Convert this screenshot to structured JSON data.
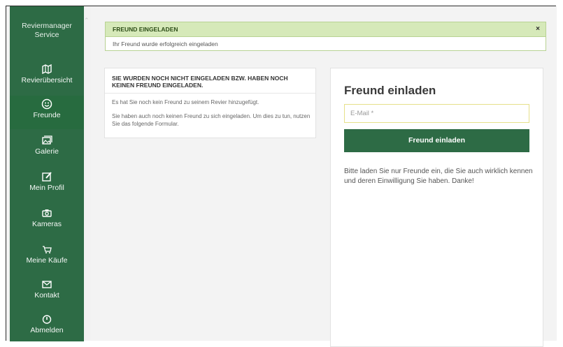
{
  "sidebar": {
    "brand": {
      "line1": "Reviermanager",
      "line2": "Service"
    },
    "items": [
      {
        "label": "Revierübersicht",
        "icon": "map-icon",
        "active": false
      },
      {
        "label": "Freunde",
        "icon": "smiley-icon",
        "active": true
      },
      {
        "label": "Galerie",
        "icon": "gallery-icon",
        "active": false
      },
      {
        "label": "Mein Profil",
        "icon": "edit-icon",
        "active": false
      },
      {
        "label": "Kameras",
        "icon": "camera-icon",
        "active": false
      },
      {
        "label": "Meine Käufe",
        "icon": "cart-icon",
        "active": false
      },
      {
        "label": "Kontakt",
        "icon": "mail-icon",
        "active": false
      },
      {
        "label": "Abmelden",
        "icon": "power-icon",
        "active": false
      }
    ]
  },
  "alert": {
    "title": "FREUND EINGELADEN",
    "close": "×",
    "message": "Ihr Freund wurde erfolgreich eingeladen"
  },
  "info_card": {
    "heading": "SIE WURDEN NOCH NICHT EINGELADEN BZW. HABEN NOCH KEINEN FREUND EINGELADEN.",
    "line1": "Es hat Sie noch kein Freund zu seinem Revier hinzugefügt.",
    "line2": "Sie haben auch noch keinen Freund zu sich eingeladen. Um dies zu tun, nutzen Sie das folgende Formular."
  },
  "invite_card": {
    "title": "Freund einladen",
    "email_placeholder": "E-Mail *",
    "submit_label": "Freund einladen",
    "note": "Bitte laden Sie nur Freunde ein, die Sie auch wirklich kennen und deren Einwilligung Sie haben. Danke!"
  },
  "colors": {
    "sidebar": "#2d6b45",
    "alert_bg": "#d6e9b9",
    "button": "#2d6b45"
  }
}
